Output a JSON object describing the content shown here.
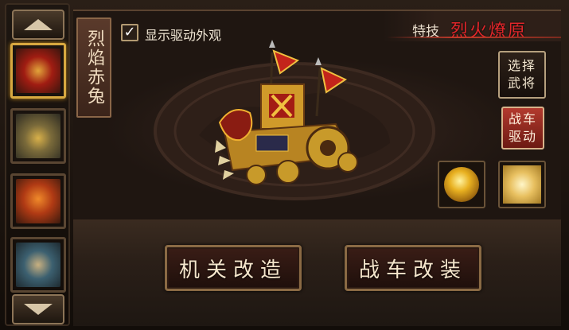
{
  "sidebar": {
    "up_icon": "triangle-up-icon",
    "down_icon": "triangle-down-icon",
    "slots": [
      {
        "name": "slot-1",
        "active": true,
        "colors": [
          "#8a1a12",
          "#d8a43a"
        ]
      },
      {
        "name": "slot-2",
        "active": false,
        "colors": [
          "#3a3a2a",
          "#c9a43e"
        ]
      },
      {
        "name": "slot-3",
        "active": false,
        "colors": [
          "#6a1a0a",
          "#e06a22"
        ]
      },
      {
        "name": "slot-4",
        "active": false,
        "colors": [
          "#2a4a5a",
          "#b8a070"
        ]
      }
    ]
  },
  "header": {
    "vehicle_name": "烈焰赤兔",
    "show_appearance_label": "显示驱动外观",
    "show_appearance_checked": true,
    "skill_tag": "特技",
    "skill_name": "烈火燎原"
  },
  "actions": {
    "select_general": "选择武将",
    "chariot_drive": "战车驱动",
    "modify_mechanism": "机关改造",
    "modify_chariot": "战车改装"
  },
  "colors": {
    "accent_gold": "#d8a940",
    "skill_red": "#e0262a",
    "button_red": "#b33a2e"
  }
}
